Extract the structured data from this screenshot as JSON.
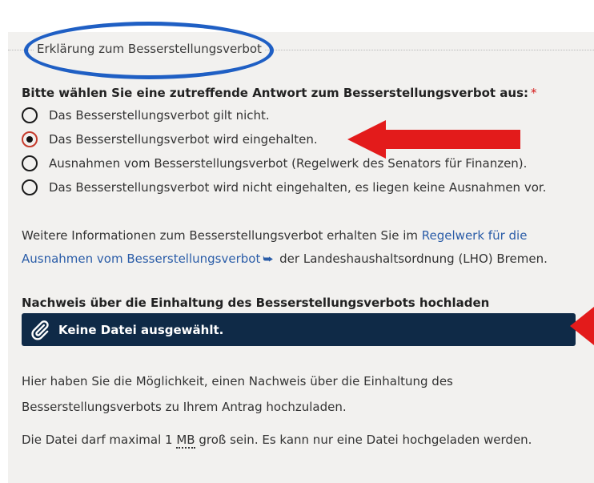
{
  "fieldset": {
    "legend": "Erklärung zum Besserstellungsverbot"
  },
  "question": {
    "label": "Bitte wählen Sie eine zutreffende Antwort zum Besserstellungsverbot aus:",
    "required_mark": "*"
  },
  "options": [
    {
      "label": "Das Besserstellungsverbot gilt nicht.",
      "checked": false
    },
    {
      "label": "Das Besserstellungsverbot wird eingehalten.",
      "checked": true
    },
    {
      "label": "Ausnahmen vom Besserstellungsverbot (Regelwerk des Senators für Finanzen).",
      "checked": false
    },
    {
      "label": "Das Besserstellungsverbot wird nicht eingehalten, es liegen keine Ausnahmen vor.",
      "checked": false
    }
  ],
  "info": {
    "text_before": "Weitere Informationen zum Besserstellungsverbot erhalten Sie im ",
    "link": "Regelwerk für die Ausnahmen vom Besserstellungsverbot",
    "text_after": " der Landeshaushaltsordnung (LHO) Bremen."
  },
  "upload": {
    "title": "Nachweis über die Einhaltung des Besserstellungsverbots hochladen",
    "button_label": "Keine Datei ausgewählt."
  },
  "help": {
    "line1": "Hier haben Sie die Möglichkeit, einen Nachweis über die Einhaltung des",
    "line2": "Besserstellungsverbots zu Ihrem Antrag hochzuladen.",
    "limit_before": "Die Datei darf maximal 1 ",
    "limit_unit": "MB",
    "limit_after": " groß sein. Es kann nur eine Datei hochgeladen werden."
  },
  "colors": {
    "annotation_ellipse": "#1f5fc4",
    "annotation_arrow": "#e31b1b",
    "upload_button_bg": "#0f2a47",
    "link": "#2b5da8",
    "required": "#d51a1a"
  }
}
